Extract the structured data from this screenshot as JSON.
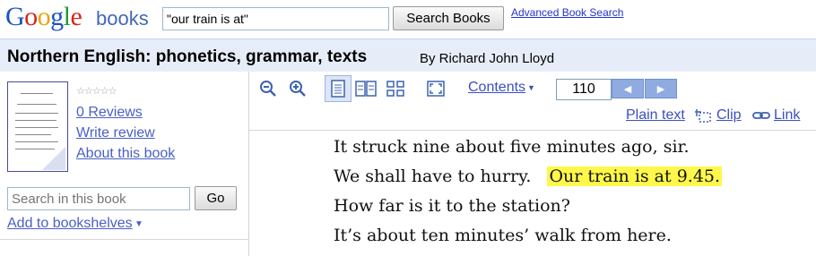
{
  "logo": {
    "google": "Google",
    "books": "books"
  },
  "search": {
    "query": "\"our train is at\"",
    "button_label": "Search Books",
    "advanced_label": "Advanced Book Search"
  },
  "book": {
    "title": "Northern English: phonetics, grammar, texts",
    "author": "By Richard John Lloyd"
  },
  "sidebar": {
    "rating_stars": "☆☆☆☆☆",
    "reviews_label": "0 Reviews",
    "write_review_label": "Write review",
    "about_label": "About this book",
    "search_placeholder": "Search in this book",
    "go_label": "Go",
    "shelves_label": "Add to bookshelves"
  },
  "toolbar": {
    "icons": [
      "zoom-out-icon",
      "zoom-in-icon",
      "one-page-view-icon",
      "two-page-view-icon",
      "thumbnail-view-icon",
      "fullscreen-icon"
    ],
    "contents_label": "Contents",
    "page_number": "110",
    "plain_text_label": "Plain text",
    "clip_label": "Clip",
    "link_label": "Link"
  },
  "page_text": {
    "line1": "It struck nine about five minutes ago, sir.",
    "line2_pre": "We shall have to hurry.",
    "line2_highlight": "Our train is at 9.45.",
    "line3": "How far is it to the station?",
    "line4": "It’s about ten minutes’ walk from here."
  },
  "colors": {
    "link": "#3a4fbf",
    "titlebar_bg": "#e7edf8",
    "highlight": "#fff84a",
    "nav_button": "#8fabe0"
  }
}
